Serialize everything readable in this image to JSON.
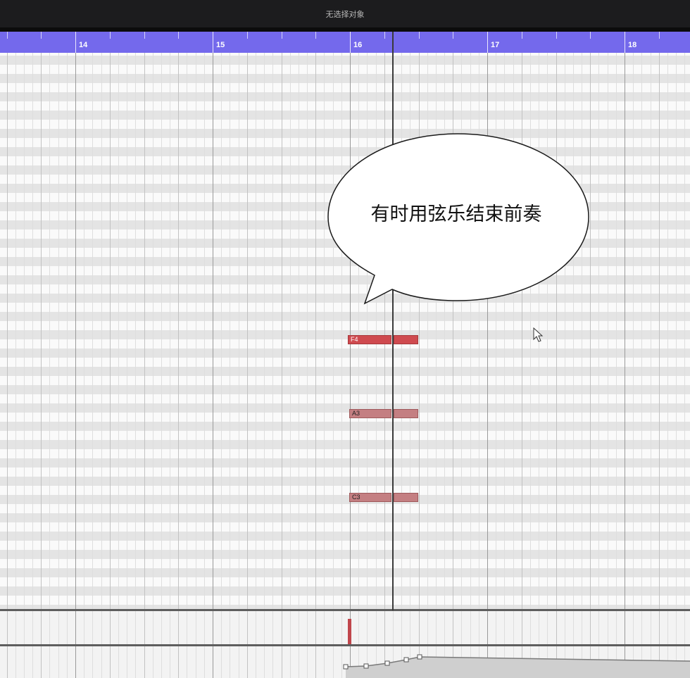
{
  "titlebar": {
    "text": "无选择对象"
  },
  "ruler": {
    "bars": [
      "14",
      "15",
      "16",
      "17",
      "18"
    ]
  },
  "notes": [
    {
      "pitch": "F4",
      "selected": true
    },
    {
      "pitch": "A3",
      "selected": false
    },
    {
      "pitch": "C3",
      "selected": false
    }
  ],
  "annotation": {
    "text": "有时用弦乐结束前奏"
  },
  "colors": {
    "ruler": "#7469ec",
    "note_selected": "#cf4a4f",
    "note": "#c47f82",
    "titlebar": "#1c1c1e"
  }
}
